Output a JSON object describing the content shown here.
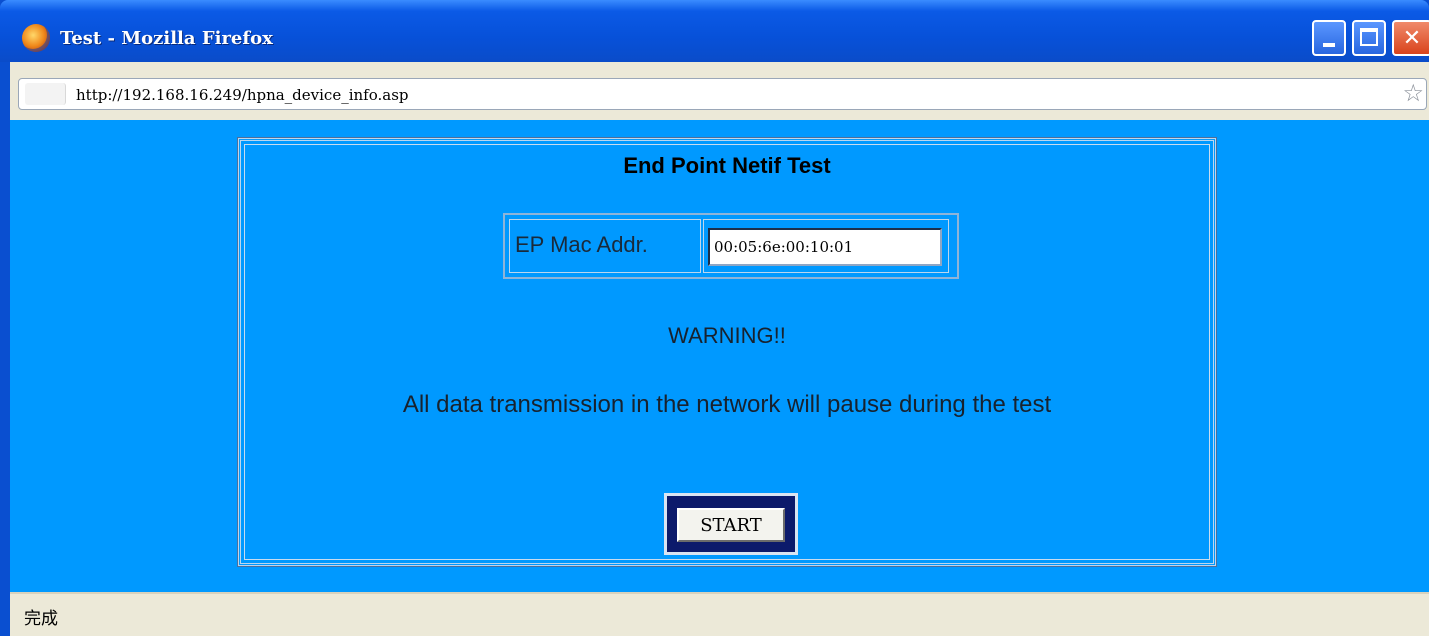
{
  "window": {
    "title": "Test - Mozilla Firefox",
    "controls": {
      "minimize_icon": "minimize-icon",
      "maximize_icon": "maximize-icon",
      "close_icon": "close-icon",
      "close_glyph": "✕"
    }
  },
  "address_bar": {
    "url": "http://192.168.16.249/hpna_device_info.asp",
    "bookmark_icon": "star-icon",
    "bookmark_glyph": "☆"
  },
  "page": {
    "background_color": "#0099ff",
    "title": "End Point Netif Test",
    "mac_label": "EP Mac Addr.",
    "mac_value": "00:05:6e:00:10:01",
    "warning": "WARNING!!",
    "notice": "All data transmission in the network will pause during the test",
    "start_label": "START"
  },
  "status_bar": {
    "text": "完成"
  }
}
